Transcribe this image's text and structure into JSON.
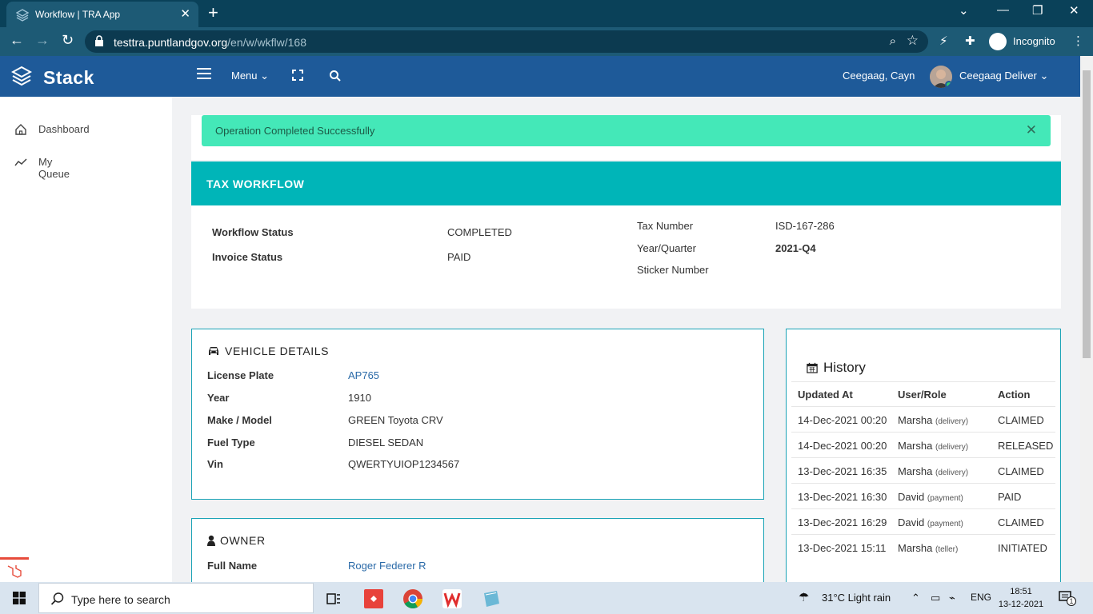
{
  "browser": {
    "tab_title": "Workflow | TRA App",
    "url_host": "testtra.puntlandgov.org",
    "url_path": "/en/w/wkflw/168",
    "incognito_label": "Incognito"
  },
  "header": {
    "brand": "Stack",
    "menu_label": "Menu",
    "user_name": "Ceegaag, Cayn",
    "user_role": "Ceegaag Deliver"
  },
  "sidebar": {
    "items": [
      {
        "label": "Dashboard",
        "icon": "home-icon"
      },
      {
        "label": "My Queue",
        "icon": "trend-icon"
      }
    ]
  },
  "alert": {
    "message": "Operation Completed Successfully"
  },
  "workflow": {
    "title": "TAX WORKFLOW",
    "workflow_status_label": "Workflow Status",
    "workflow_status_value": "COMPLETED",
    "invoice_status_label": "Invoice Status",
    "invoice_status_value": "PAID",
    "tax_number_label": "Tax Number",
    "tax_number_value": "ISD-167-286",
    "year_quarter_label": "Year/Quarter",
    "year_quarter_value": "2021-Q4",
    "sticker_number_label": "Sticker Number"
  },
  "vehicle": {
    "title": "VEHICLE DETAILS",
    "license_plate_label": "License Plate",
    "license_plate_value": "AP765",
    "year_label": "Year",
    "year_value": "1910",
    "make_model_label": "Make / Model",
    "make_model_value": "GREEN Toyota CRV",
    "fuel_type_label": "Fuel Type",
    "fuel_type_value": "DIESEL SEDAN",
    "vin_label": "Vin",
    "vin_value": "QWERTYUIOP1234567"
  },
  "owner": {
    "title": "OWNER",
    "full_name_label": "Full Name",
    "full_name_value": "Roger Federer R"
  },
  "history": {
    "title": "History",
    "headers": [
      "Updated At",
      "User/Role",
      "Action"
    ],
    "rows": [
      {
        "at": "14-Dec-2021 00:20",
        "user": "Marsha",
        "role": "(delivery)",
        "action": "CLAIMED"
      },
      {
        "at": "14-Dec-2021 00:20",
        "user": "Marsha",
        "role": "(delivery)",
        "action": "RELEASED"
      },
      {
        "at": "13-Dec-2021 16:35",
        "user": "Marsha",
        "role": "(delivery)",
        "action": "CLAIMED"
      },
      {
        "at": "13-Dec-2021 16:30",
        "user": "David",
        "role": "(payment)",
        "action": "PAID"
      },
      {
        "at": "13-Dec-2021 16:29",
        "user": "David",
        "role": "(payment)",
        "action": "CLAIMED"
      },
      {
        "at": "13-Dec-2021 15:11",
        "user": "Marsha",
        "role": "(teller)",
        "action": "INITIATED"
      }
    ]
  },
  "taskbar": {
    "search_placeholder": "Type here to search",
    "weather": "31°C  Light rain",
    "language": "ENG",
    "time": "18:51",
    "date": "13-12-2021",
    "notification_count": "1"
  },
  "colors": {
    "header_blue": "#1e5a99",
    "teal": "#00b5b8",
    "alert_green": "#44e8b8",
    "link_blue": "#2a6aa8"
  }
}
